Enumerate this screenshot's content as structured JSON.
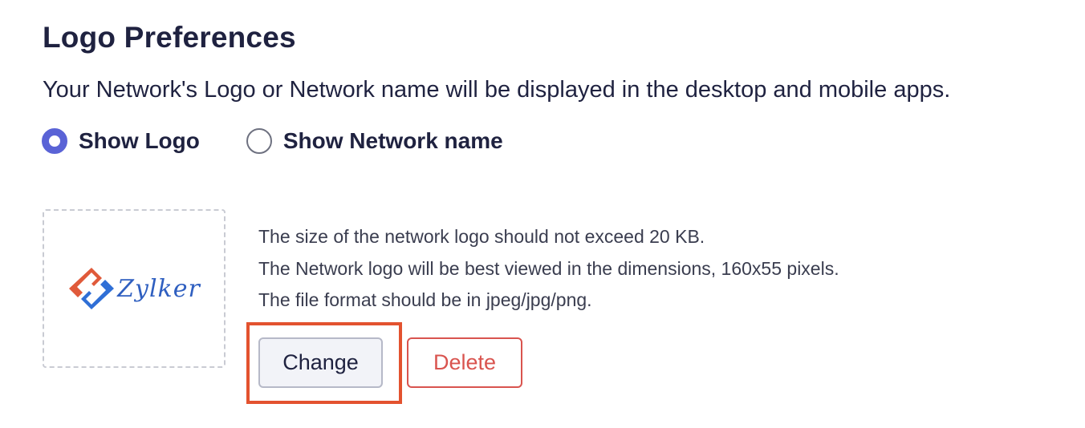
{
  "header": {
    "title": "Logo Preferences",
    "description": "Your Network's Logo or Network name will be displayed in the desktop and mobile apps."
  },
  "display_option": {
    "options": [
      {
        "label": "Show Logo",
        "selected": true
      },
      {
        "label": "Show Network name",
        "selected": false
      }
    ]
  },
  "logo": {
    "brand_text": "Zylker",
    "colors": {
      "red": "#e05a3a",
      "blue": "#2f6fd6"
    }
  },
  "info": {
    "lines": [
      "The size of the network logo should not exceed 20 KB.",
      "The Network logo will be best viewed in the dimensions, 160x55 pixels.",
      "The file format should be in jpeg/jpg/png."
    ]
  },
  "actions": {
    "change_label": "Change",
    "delete_label": "Delete"
  },
  "colors": {
    "accent": "#5a63d6",
    "text": "#1f2240",
    "highlight": "#e3522f",
    "danger": "#d9544f"
  }
}
